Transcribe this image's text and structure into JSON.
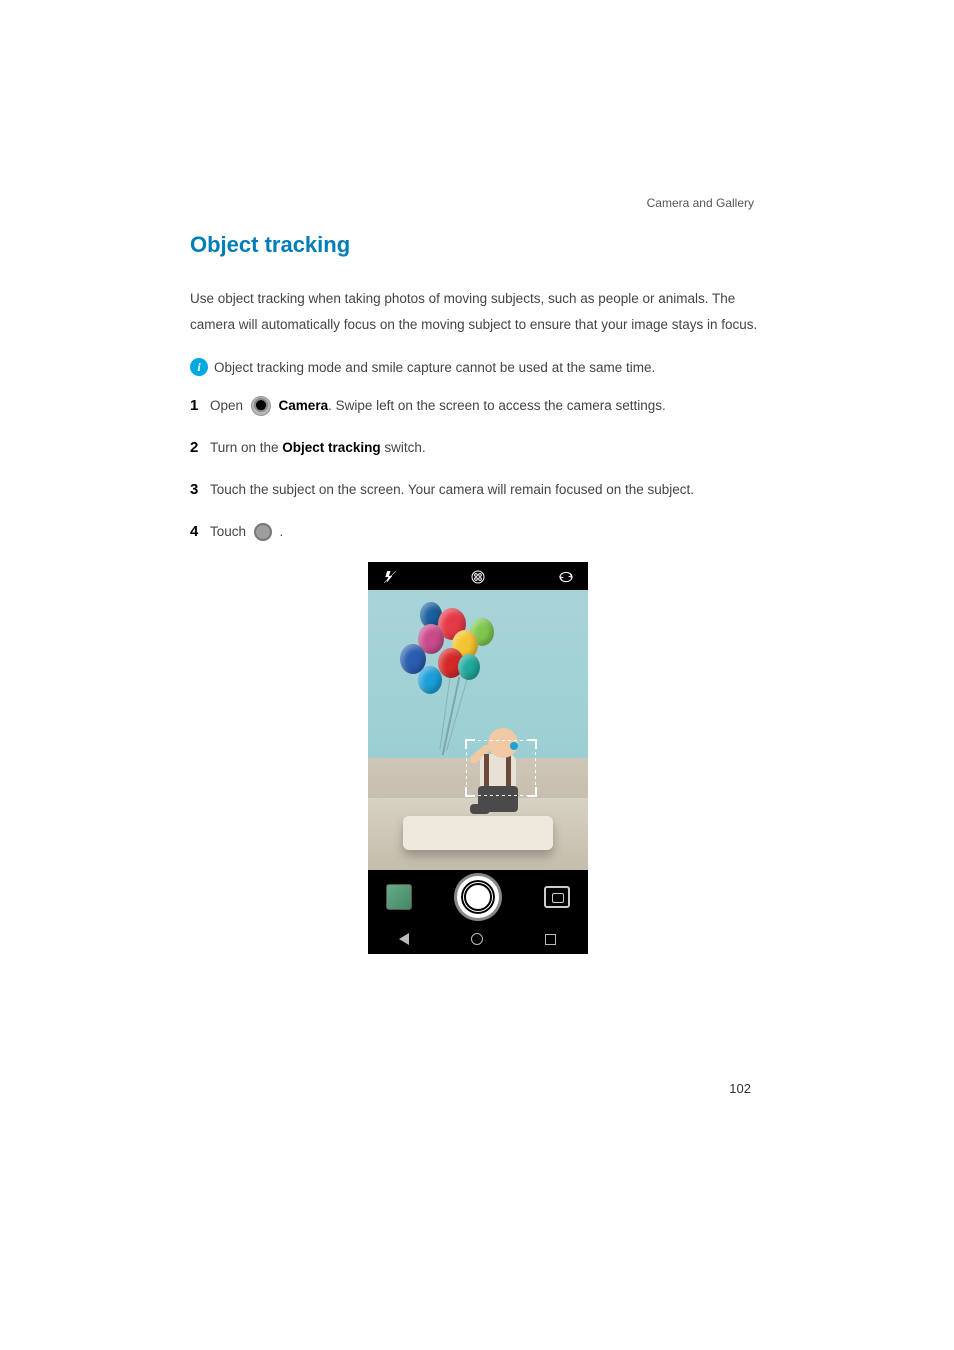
{
  "header": {
    "label": "Camera and Gallery"
  },
  "title": "Object tracking",
  "intro": "Use object tracking when taking photos of moving subjects, such as people or animals. The camera will automatically focus on the moving subject to ensure that your image stays in focus.",
  "note": "Object tracking mode and smile capture cannot be used at the same time.",
  "steps": {
    "s1_a": "Open ",
    "s1_app": "Camera",
    "s1_b": ". Swipe left on the screen to access the camera settings.",
    "s2_a": "Turn on the ",
    "s2_bold": "Object tracking",
    "s2_b": " switch.",
    "s3": "Touch the subject on the screen. Your camera will remain focused on the subject.",
    "s4_a": "Touch ",
    "s4_b": " ."
  },
  "icons": {
    "info": "i",
    "camera_app": "camera-app-icon",
    "shutter_inline": "shutter-icon"
  },
  "page_number": "102"
}
